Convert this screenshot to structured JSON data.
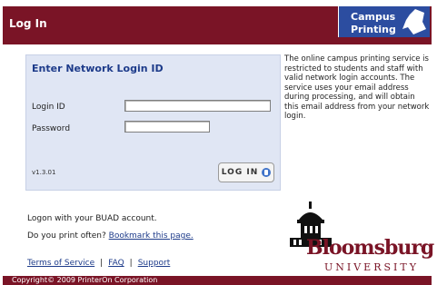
{
  "header": {
    "title": "Log In"
  },
  "brand": {
    "line1": "Campus",
    "line2": "Printing"
  },
  "login_panel": {
    "title": "Enter Network Login ID",
    "login_id_label": "Login ID",
    "password_label": "Password",
    "login_id_value": "",
    "password_value": "",
    "version": "v1.3.01",
    "login_button_label": "LOG IN"
  },
  "info_text": "The online campus printing service is restricted to students and staff with valid network login accounts. The service uses your email address during processing, and will obtain this email address from your network login.",
  "messages": {
    "logon": "Logon with your BUAD account.",
    "print_often": "Do you print often?",
    "bookmark_link": "Bookmark this page."
  },
  "footer_links": {
    "terms": "Terms of Service",
    "faq": "FAQ",
    "support": "Support"
  },
  "logo": {
    "name": "Bloomsburg",
    "subname": "UNIVERSITY"
  },
  "copyright": "Copyright© 2009 PrinterOn Corporation",
  "colors": {
    "header": "#7a1426",
    "brand": "#2c4da0",
    "panel": "#e0e6f4",
    "link": "#1d3b8a"
  }
}
